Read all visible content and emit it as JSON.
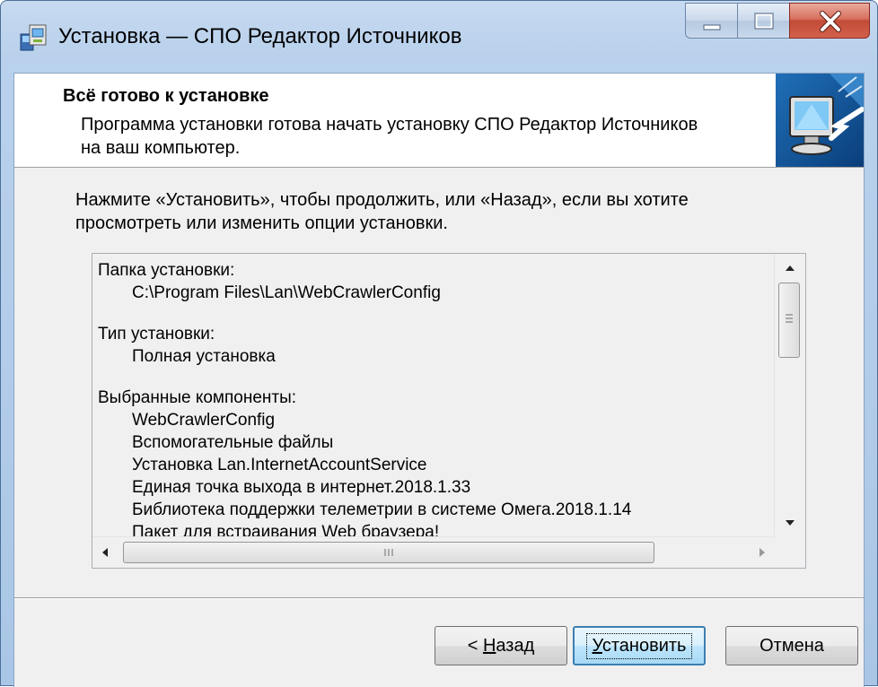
{
  "window": {
    "title": "Установка — СПО Редактор Источников"
  },
  "header": {
    "title": "Всё готово к установке",
    "description": "Программа установки готова начать установку СПО Редактор Источников на ваш компьютер."
  },
  "instruction": "Нажмите «Установить», чтобы продолжить, или «Назад», если вы хотите просмотреть или изменить опции установки.",
  "memo": {
    "install_folder_label": "Папка установки:",
    "install_folder_value": "C:\\Program Files\\Lan\\WebCrawlerConfig",
    "setup_type_label": "Тип установки:",
    "setup_type_value": "Полная установка",
    "components_label": "Выбранные компоненты:",
    "components": [
      "WebCrawlerConfig",
      "Вспомогательные файлы",
      "Установка Lan.InternetAccountService",
      "Единая точка выхода в интернет.2018.1.33",
      "Библиотека поддержки телеметрии в системе Омега.2018.1.14",
      "Пакет для встраивания Web браузера!"
    ]
  },
  "buttons": {
    "back": {
      "prefix": "< ",
      "accel": "Н",
      "rest": "азад"
    },
    "install": {
      "accel": "У",
      "rest": "становить"
    },
    "cancel": "Отмена"
  },
  "colors": {
    "titlebar": "#b9d1ec",
    "close_button": "#c24b37",
    "client_bg": "#f0f0f0",
    "default_button_border": "#3c7fb1"
  }
}
